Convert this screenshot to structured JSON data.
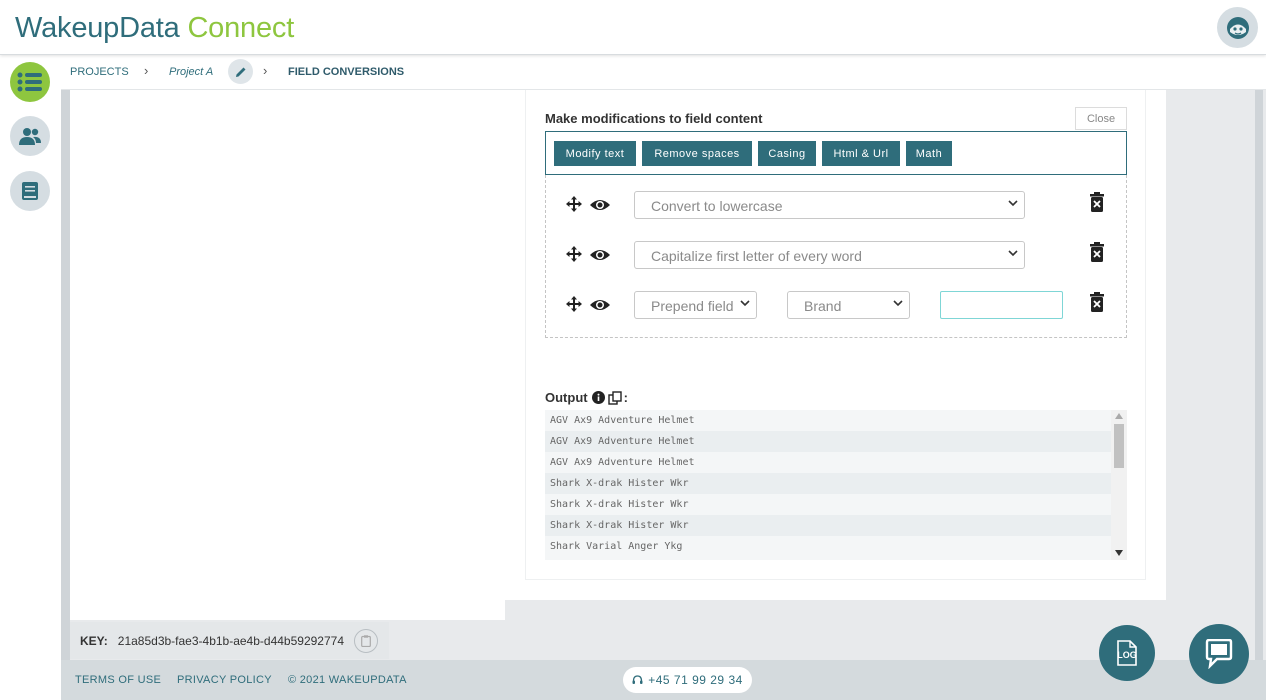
{
  "app": {
    "brand_part1": "WakeupData",
    "brand_part2": "Connect"
  },
  "breadcrumb": {
    "projects": "PROJECTS",
    "project": "Project A",
    "current": "FIELD CONVERSIONS"
  },
  "modifier": {
    "title": "Make modifications to field content",
    "close_label": "Close",
    "tabs": [
      "Modify text",
      "Remove spaces",
      "Casing",
      "Html & Url",
      "Math"
    ],
    "rules": [
      {
        "selected": "Convert to lowercase"
      },
      {
        "selected": "Capitalize first letter of every word"
      },
      {
        "selected": "Prepend field",
        "field": "Brand",
        "text_value": ""
      }
    ]
  },
  "output": {
    "label": "Output",
    "lines": [
      "AGV Ax9 Adventure Helmet",
      "AGV Ax9 Adventure Helmet",
      "AGV Ax9 Adventure Helmet",
      "Shark X-drak Hister Wkr",
      "Shark X-drak Hister Wkr",
      "Shark X-drak Hister Wkr",
      "Shark Varial Anger Ykg"
    ]
  },
  "key": {
    "label": "KEY:",
    "value": "21a85d3b-fae3-4b1b-ae4b-d44b59292774"
  },
  "footer": {
    "terms": "TERMS OF USE",
    "privacy": "PRIVACY POLICY",
    "copyright": "© 2021 WAKEUPDATA",
    "phone": "+45 71 99 29 34"
  },
  "log_label": "LOG",
  "colors": {
    "primary": "#2f6d7b",
    "accent_green": "#8ec63f",
    "background": "#e8eaec"
  }
}
